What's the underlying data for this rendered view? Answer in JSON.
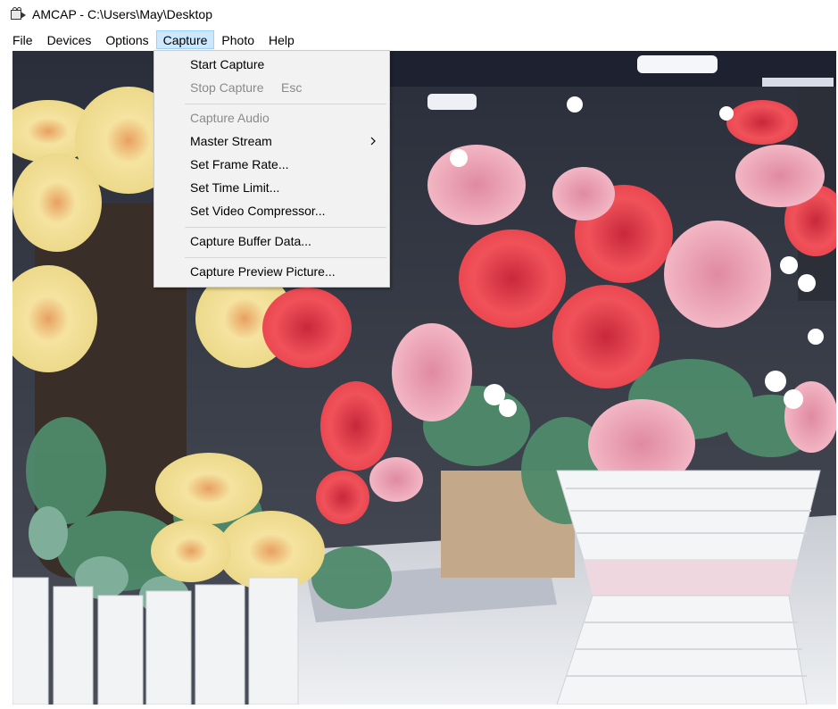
{
  "window": {
    "title": "AMCAP - C:\\Users\\May\\Desktop",
    "icon": "camera-icon"
  },
  "menubar": {
    "items": [
      {
        "label": "File"
      },
      {
        "label": "Devices"
      },
      {
        "label": "Options"
      },
      {
        "label": "Capture",
        "active": true
      },
      {
        "label": "Photo"
      },
      {
        "label": "Help"
      }
    ]
  },
  "capture_menu": {
    "items": [
      {
        "label": "Start Capture",
        "enabled": true
      },
      {
        "label": "Stop Capture",
        "shortcut": "Esc",
        "enabled": false
      },
      {
        "label": "Capture Audio",
        "enabled": false
      },
      {
        "label": "Master Stream",
        "submenu": true,
        "submenu_icon": "chevron-right-icon",
        "enabled": true
      },
      {
        "label": "Set Frame Rate...",
        "enabled": true
      },
      {
        "label": "Set Time Limit...",
        "enabled": true
      },
      {
        "label": "Set Video Compressor...",
        "enabled": true
      },
      {
        "label": "Capture Buffer Data...",
        "enabled": true
      },
      {
        "label": "Capture Preview Picture...",
        "enabled": true
      }
    ]
  },
  "colors": {
    "menu_highlight": "#cce8ff",
    "menu_bg": "#f2f2f2",
    "disabled_text": "#8a8a8a"
  }
}
